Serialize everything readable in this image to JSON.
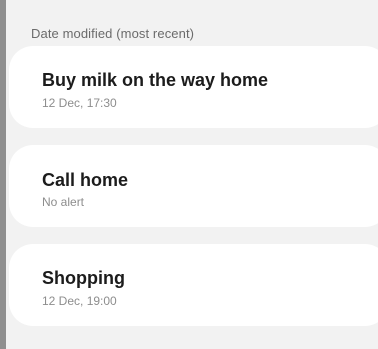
{
  "header": {
    "sort_label": "Date modified (most recent)"
  },
  "reminders": [
    {
      "title": "Buy milk on the way home",
      "subtitle": "12 Dec, 17:30"
    },
    {
      "title": "Call home",
      "subtitle": "No alert"
    },
    {
      "title": "Shopping",
      "subtitle": "12 Dec, 19:00"
    }
  ],
  "colors": {
    "background": "#f2f2f2",
    "card": "#ffffff",
    "title_text": "#1c1c1c",
    "subtitle_text": "#8d8d8d"
  }
}
